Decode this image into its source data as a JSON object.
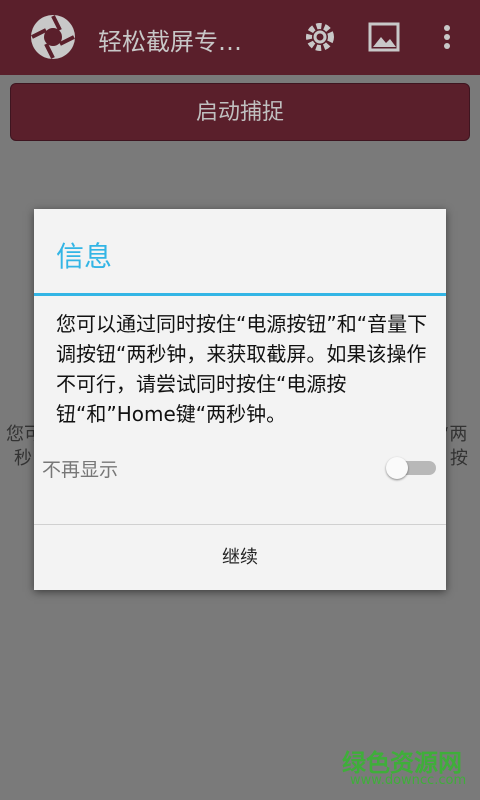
{
  "app": {
    "title": "轻松截屏专…",
    "capture_button": "启动捕捉",
    "bg_text_left_line1": "您可",
    "bg_text_left_line2": "秒",
    "bg_text_right_line1": "“两",
    "bg_text_right_line2": "按"
  },
  "dialog": {
    "title": "信息",
    "message": "您可以通过同时按住“电源按钮”和“音量下调按钮“两秒钟，来获取截屏。如果该操作不可行，请尝试同时按住“电源按钮“和”Home键“两秒钟。",
    "checkbox_label": "不再显示",
    "toggle_state": "off",
    "continue_label": "继续"
  },
  "watermark": {
    "name": "绿色资源网",
    "url": "www.downcc.com"
  },
  "colors": {
    "appbar": "#5a1f2b",
    "accent": "#33b5e5",
    "watermark": "#3fae3a"
  }
}
